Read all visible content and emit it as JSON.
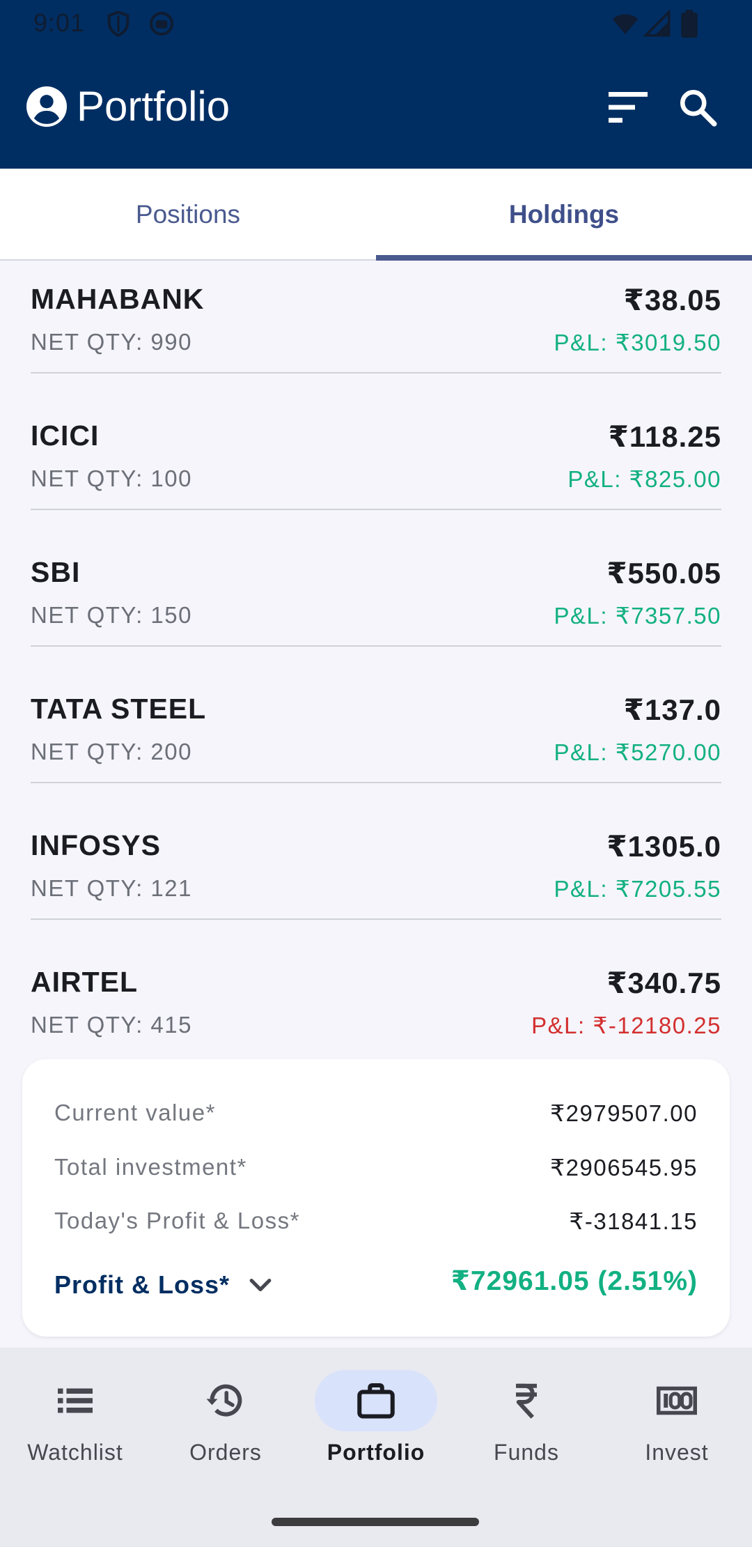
{
  "status_bar": {
    "time": "9:01",
    "icons": [
      "shield-icon",
      "media-icon",
      "wifi-icon",
      "signal-icon",
      "battery-icon"
    ]
  },
  "header": {
    "title": "Portfolio",
    "icons": [
      "account-circle-icon",
      "sort-icon",
      "search-icon"
    ],
    "background": "#002e62"
  },
  "tabs": {
    "positions": "Positions",
    "holdings": "Holdings",
    "active": "Holdings"
  },
  "holdings": [
    {
      "name": "MAHABANK",
      "qty": "NET QTY: 990",
      "price": "₹38.05",
      "pnl": "P&L: ₹3019.50",
      "pnl_sign": "positive"
    },
    {
      "name": "ICICI",
      "qty": "NET QTY: 100",
      "price": "₹118.25",
      "pnl": "P&L: ₹825.00",
      "pnl_sign": "positive"
    },
    {
      "name": "SBI",
      "qty": "NET QTY: 150",
      "price": "₹550.05",
      "pnl": "P&L: ₹7357.50",
      "pnl_sign": "positive"
    },
    {
      "name": "TATA STEEL",
      "qty": "NET QTY: 200",
      "price": "₹137.0",
      "pnl": "P&L: ₹5270.00",
      "pnl_sign": "positive"
    },
    {
      "name": "INFOSYS",
      "qty": "NET QTY: 121",
      "price": "₹1305.0",
      "pnl": "P&L: ₹7205.55",
      "pnl_sign": "positive"
    },
    {
      "name": "AIRTEL",
      "qty": "NET QTY: 415",
      "price": "₹340.75",
      "pnl": "P&L: ₹-12180.25",
      "pnl_sign": "negative"
    }
  ],
  "summary": {
    "current_value_label": "Current value*",
    "current_value": "₹2979507.00",
    "total_investment_label": "Total investment*",
    "total_investment": "₹2906545.95",
    "todays_pnl_label": "Today's Profit & Loss*",
    "todays_pnl": "₹-31841.15",
    "pnl_label": "Profit & Loss*",
    "pnl_total": "₹72961.05 (2.51%)"
  },
  "colors": {
    "positive": "#12b082",
    "negative": "#d32f2f",
    "accent": "#4a5a8f"
  },
  "bottom_nav": {
    "items": [
      {
        "label": "Watchlist",
        "icon": "list-icon"
      },
      {
        "label": "Orders",
        "icon": "history-icon"
      },
      {
        "label": "Portfolio",
        "icon": "briefcase-icon"
      },
      {
        "label": "Funds",
        "icon": "rupee-icon"
      },
      {
        "label": "Invest",
        "icon": "cash-icon"
      }
    ],
    "active": "Portfolio"
  }
}
